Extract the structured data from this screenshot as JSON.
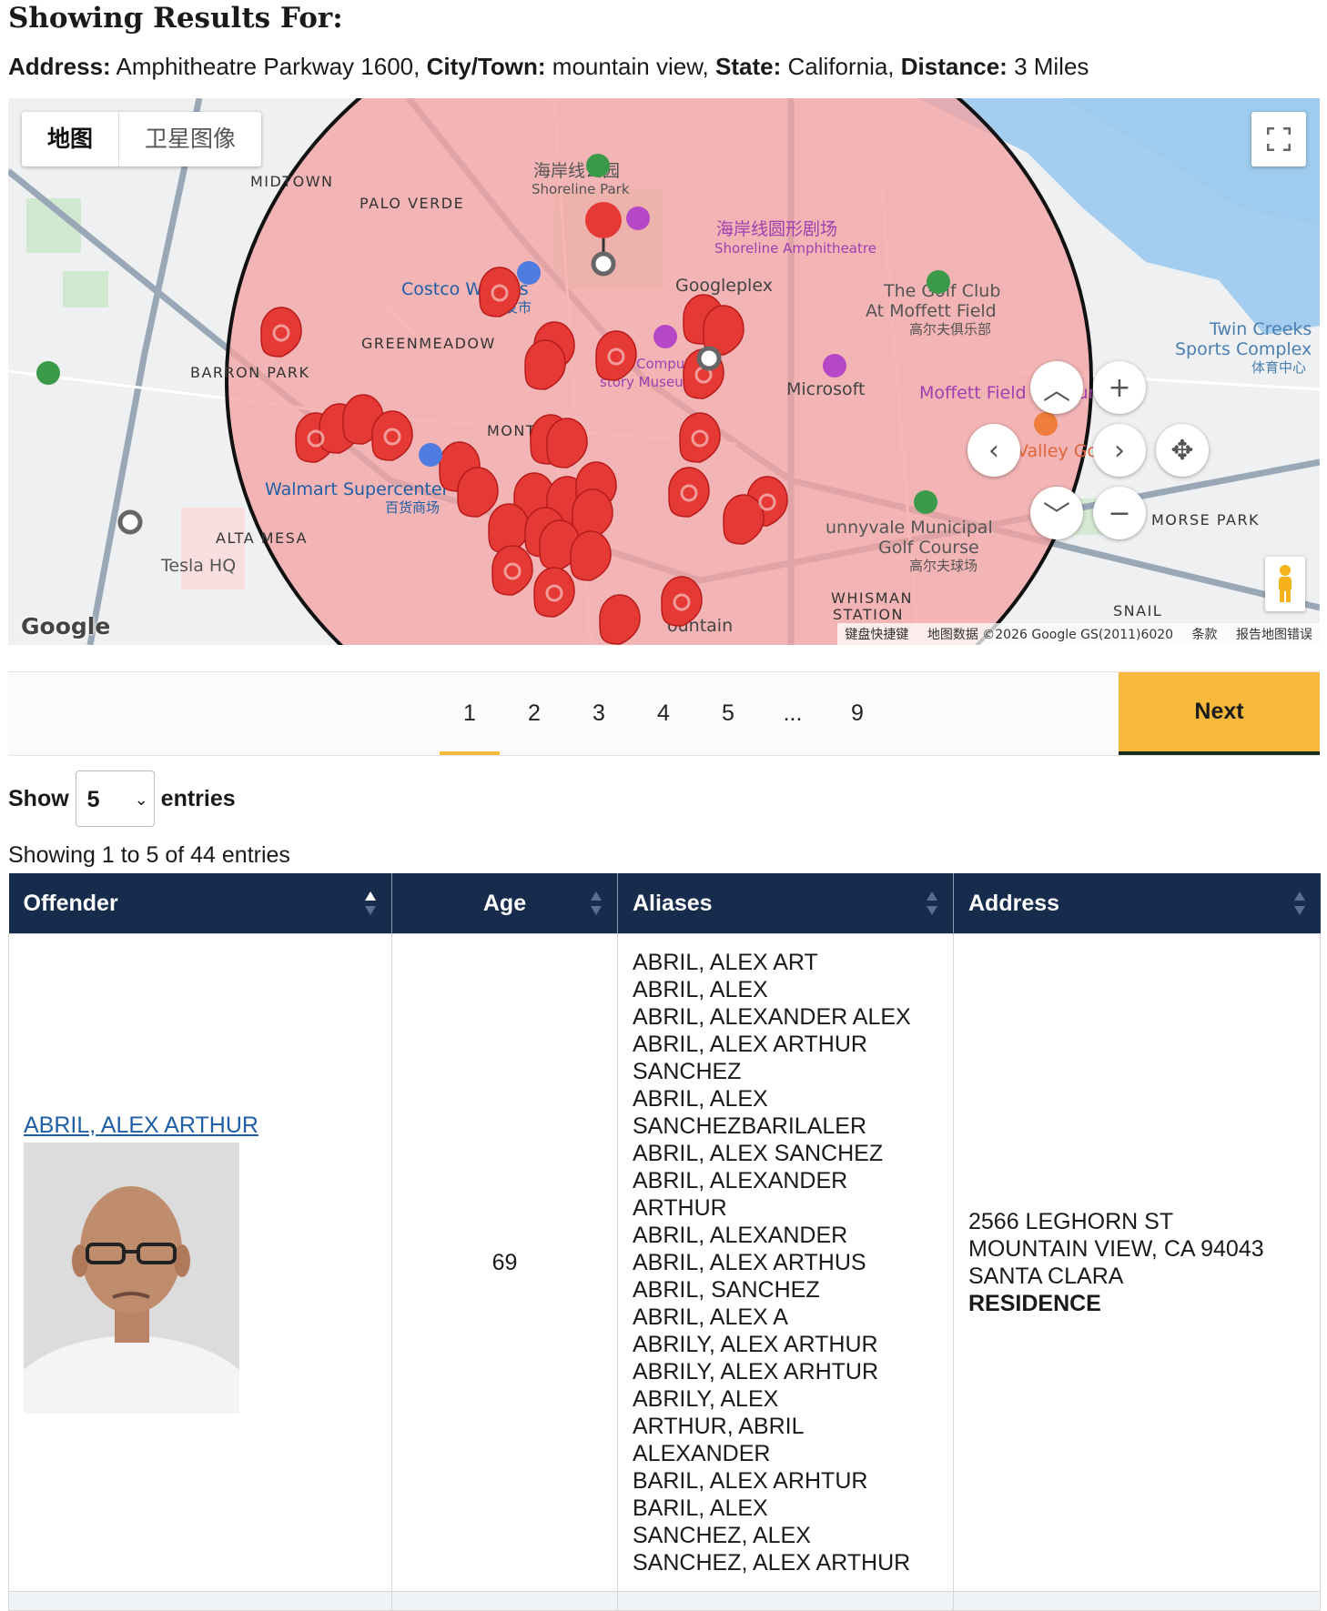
{
  "header": {
    "title": "Showing Results For:",
    "address_label": "Address:",
    "address_value": "Amphitheatre Parkway 1600,",
    "city_label": "City/Town:",
    "city_value": "mountain view,",
    "state_label": "State:",
    "state_value": "California,",
    "distance_label": "Distance:",
    "distance_value": "3 Miles"
  },
  "map": {
    "type_map": "地图",
    "type_satellite": "卫星图像",
    "attribution": {
      "shortcuts": "键盘快捷键",
      "data": "地图数据 ©2026 Google GS(2011)6020",
      "terms": "条款",
      "report": "报告地图错误"
    },
    "logo": "Google",
    "labels": {
      "midtown": "MIDTOWN",
      "palo_verde": "PALO VERDE",
      "greenmeadow": "GREENMEADOW",
      "barron_park": "BARRON PARK",
      "monta_loma": "MONTA LO",
      "alta_mesa": "ALTA MESA",
      "whisman": "WHISMAN",
      "station": "STATION",
      "morse_park": "MORSE PARK",
      "snail": "SNAIL",
      "shoreline_cn": "海岸线公园",
      "shoreline_en": "Shoreline Park",
      "amph_cn": "海岸线圆形剧场",
      "amph_en": "Shoreline Amphitheatre",
      "googleplex": "Googleplex",
      "costco": "Costco Wholes",
      "costco_cn": "批发市",
      "microsoft": "Microsoft",
      "moffett": "Moffett Field Museum",
      "golf1": "The Golf Club",
      "golf2": "At Moffett Field",
      "golf3": "高尔夫俱乐部",
      "twin1": "Twin Creeks",
      "twin2": "Sports Complex",
      "twin3": "体育中心",
      "walmart": "Walmart Supercenter",
      "walmart_cn": "百货商场",
      "tesla": "Tesla HQ",
      "valley": "Valley Goat",
      "sunnyvale1": "unnyvale Municipal",
      "sunnyvale2": "Golf Course",
      "sunnyvale3": "高尔夫球场",
      "computer": "Computer",
      "museum": "story Museum",
      "mountain": "ountain"
    },
    "pin_color": "#e53935",
    "radius_fill": "#f4a3a3"
  },
  "pagination": {
    "pages": [
      "1",
      "2",
      "3",
      "4",
      "5",
      "...",
      "9"
    ],
    "current": "1",
    "next_label": "Next"
  },
  "entries": {
    "show_label": "Show",
    "selected": "5",
    "entries_label": "entries",
    "info": "Showing 1 to 5 of 44 entries"
  },
  "table": {
    "columns": [
      "Offender",
      "Age",
      "Aliases",
      "Address"
    ],
    "rows": [
      {
        "name": "ABRIL, ALEX ARTHUR",
        "age": "69",
        "aliases": [
          "ABRIL, ALEX ART",
          "ABRIL, ALEX",
          "ABRIL, ALEXANDER ALEX",
          "ABRIL, ALEX ARTHUR SANCHEZ",
          "ABRIL, ALEX SANCHEZBARILALER",
          "ABRIL, ALEX SANCHEZ",
          "ABRIL, ALEXANDER ARTHUR",
          "ABRIL, ALEXANDER",
          "ABRIL, ALEX ARTHUS",
          "ABRIL, SANCHEZ",
          "ABRIL, ALEX A",
          "ABRILY, ALEX ARTHUR",
          "ABRILY, ALEX ARHTUR",
          "ABRILY, ALEX",
          "ARTHUR, ABRIL ALEXANDER",
          "BARIL, ALEX ARHTUR",
          "BARIL, ALEX",
          "SANCHEZ, ALEX",
          "SANCHEZ, ALEX ARTHUR"
        ],
        "address": {
          "street": "2566 LEGHORN ST",
          "city": "MOUNTAIN VIEW, CA 94043",
          "county": "SANTA CLARA",
          "type": "RESIDENCE"
        }
      }
    ]
  },
  "colors": {
    "header_bg": "#172b4d",
    "accent": "#f6b93b",
    "link": "#1f5fa6"
  }
}
